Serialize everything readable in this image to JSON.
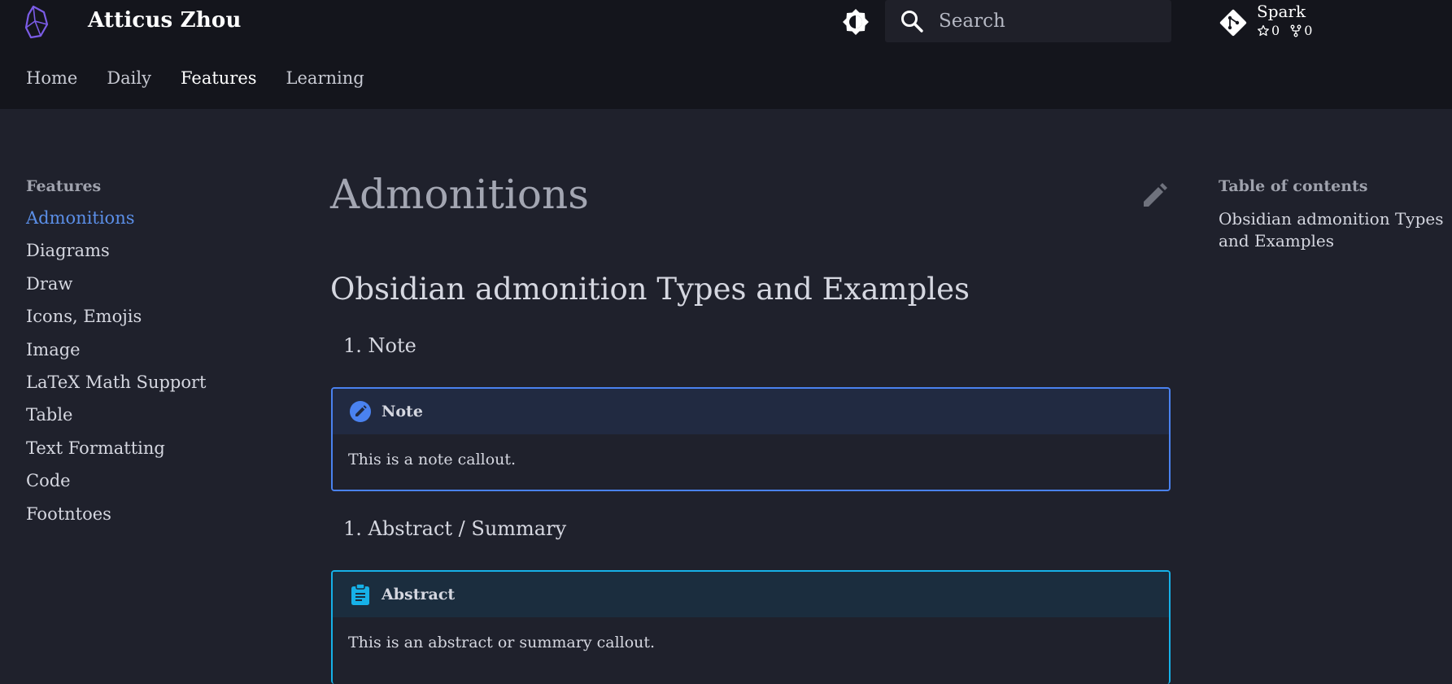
{
  "header": {
    "site_title": "Atticus Zhou",
    "search_placeholder": "Search",
    "repo": {
      "name": "Spark",
      "stars": "0",
      "forks": "0"
    },
    "tabs": [
      {
        "label": "Home",
        "active": false
      },
      {
        "label": "Daily",
        "active": false
      },
      {
        "label": "Features",
        "active": true
      },
      {
        "label": "Learning",
        "active": false
      }
    ]
  },
  "sidebar": {
    "title": "Features",
    "items": [
      {
        "label": "Admonitions",
        "active": true
      },
      {
        "label": "Diagrams"
      },
      {
        "label": "Draw"
      },
      {
        "label": "Icons, Emojis"
      },
      {
        "label": "Image"
      },
      {
        "label": "LaTeX Math Support"
      },
      {
        "label": "Table"
      },
      {
        "label": "Text Formatting"
      },
      {
        "label": "Code"
      },
      {
        "label": "Footntoes"
      }
    ]
  },
  "main": {
    "title": "Admonitions",
    "heading": "Obsidian admonition Types and Examples",
    "sections": [
      {
        "list_item": "1. Note",
        "callout_title": "Note",
        "callout_body": "This is a note callout.",
        "icon": "pencil-circle-icon"
      },
      {
        "list_item": "1. Abstract / Summary",
        "callout_title": "Abstract",
        "callout_body": "This is an abstract or summary callout.",
        "icon": "clipboard-icon"
      }
    ]
  },
  "toc": {
    "title": "Table of contents",
    "items": [
      {
        "label": "Obsidian admonition Types and Examples"
      }
    ]
  },
  "colors": {
    "background": "#1f212c",
    "header": "#14151c",
    "accent_link": "#5b8fe8",
    "note_border": "#4a82f0",
    "abstract_border": "#16b1e8"
  }
}
